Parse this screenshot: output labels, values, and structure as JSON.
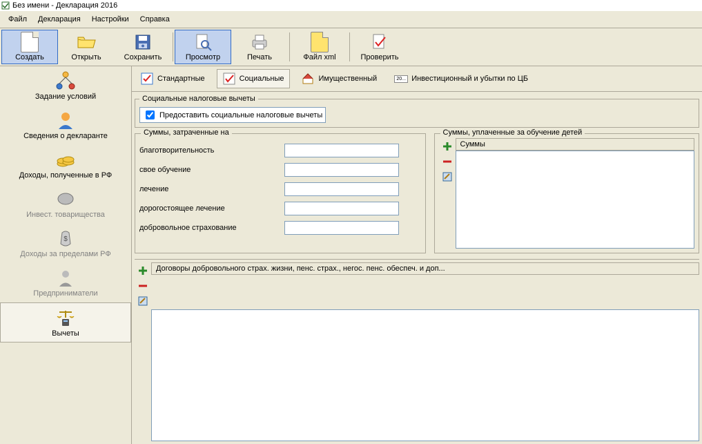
{
  "title": "Без имени - Декларация 2016",
  "menu": {
    "file": "Файл",
    "decl": "Декларация",
    "settings": "Настройки",
    "help": "Справка"
  },
  "toolbar": {
    "create": "Создать",
    "open": "Открыть",
    "save": "Сохранить",
    "view": "Просмотр",
    "print": "Печать",
    "xml": "Файл xml",
    "check": "Проверить"
  },
  "sidebar": {
    "conditions": "Задание условий",
    "declarant": "Сведения о декларанте",
    "income_rf": "Доходы, полученные в РФ",
    "invest": "Инвест. товарищества",
    "income_abroad": "Доходы за пределами РФ",
    "entrepreneurs": "Предприниматели",
    "deductions": "Вычеты"
  },
  "tabs": {
    "standard": "Стандартные",
    "social": "Социальные",
    "property": "Имущественный",
    "investment": "Инвестиционный и убытки по ЦБ",
    "investment_badge": "20..."
  },
  "panel_title": "Социальные налоговые вычеты",
  "provide": "Предоставить социальные налоговые вычеты",
  "spent_title": "Суммы, затраченные на",
  "fields": {
    "charity": "благотворительность",
    "education": "свое обучение",
    "treatment": "лечение",
    "expensive_treatment": "дорогостоящее лечение",
    "insurance": "добровольное страхование"
  },
  "values": {
    "charity": "",
    "education": "",
    "treatment": "",
    "expensive_treatment": "",
    "insurance": ""
  },
  "education_title": "Суммы, уплаченные за обучение детей",
  "education_header": "Суммы",
  "contracts_header": "Договоры добровольного страх. жизни, пенс. страх., негос. пенс. обеспеч. и доп..."
}
